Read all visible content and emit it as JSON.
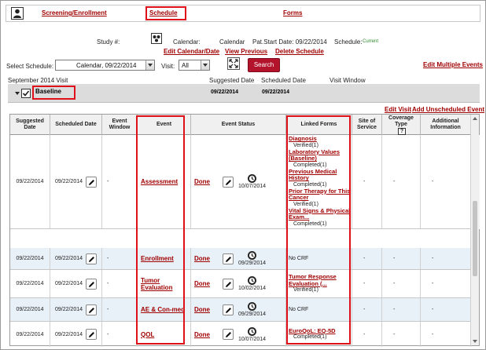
{
  "nav": {
    "tabs": [
      "Screening/Enrollment",
      "Schedule",
      "Forms"
    ]
  },
  "calendar_info": {
    "study_label": "Study #:",
    "calendar_label": "Calendar:",
    "calendar_value": "Calendar",
    "pat_start": "Pat.Start Date: 09/22/2014",
    "schedule_label": "Schedule:",
    "schedule_status": "Current",
    "links": {
      "edit_calendar": "Edit Calendar/Date",
      "view_previous": "View Previous",
      "delete_schedule": "Delete Schedule"
    }
  },
  "selection": {
    "select_schedule_label": "Select Schedule:",
    "schedule_value": "Calendar, 09/22/2014",
    "visit_label": "Visit:",
    "visit_value": "All",
    "search_button": "Search",
    "edit_multiple_events": "Edit Multiple Events"
  },
  "visit_header": {
    "month": "September 2014 Visit",
    "suggested_date": "Suggested Date",
    "scheduled_date": "Scheduled Date",
    "visit_window": "Visit Window"
  },
  "baseline": {
    "name": "Baseline",
    "suggested": "09/22/2014",
    "scheduled": "09/22/2014"
  },
  "visit_links": {
    "edit_visit": "Edit Visit",
    "add_unscheduled": "Add Unscheduled Event"
  },
  "table": {
    "headers": [
      "Suggested Date",
      "Scheduled Date",
      "Event Window",
      "Event",
      "Event Status",
      "Linked Forms",
      "Site of Service",
      "Coverage Type",
      "Additional Information"
    ],
    "coverage_help": "?",
    "rows": [
      {
        "suggested": "09/22/2014",
        "scheduled": "09/22/2014",
        "window": "-",
        "event": "Assessment",
        "status": "Done",
        "status_date": "10/07/2014",
        "forms": [
          {
            "name": "Diagnosis",
            "status": "Verified(1)"
          },
          {
            "name": "Laboratory Values (Baseline)",
            "status": "Completed(1)"
          },
          {
            "name": "Previous Medical History",
            "status": "Completed(1)"
          },
          {
            "name": "Prior Therapy for This Cancer",
            "status": "Verified(1)"
          },
          {
            "name": "Vital Signs & Physical Exam...",
            "status": "Completed(1)"
          }
        ],
        "site": "-",
        "coverage": "-",
        "info": "-"
      },
      {
        "suggested": "09/22/2014",
        "scheduled": "09/22/2014",
        "window": "-",
        "event": "Enrollment",
        "status": "Done",
        "status_date": "09/29/2014",
        "forms_text": "No CRF",
        "site": "-",
        "coverage": "-",
        "info": "-"
      },
      {
        "suggested": "09/22/2014",
        "scheduled": "09/22/2014",
        "window": "-",
        "event": "Tumor Evaluation",
        "status": "Done",
        "status_date": "10/02/2014",
        "forms": [
          {
            "name": "Tumor Response Evaluation (...",
            "status": "Verified(1)"
          }
        ],
        "site": "-",
        "coverage": "-",
        "info": "-"
      },
      {
        "suggested": "09/22/2014",
        "scheduled": "09/22/2014",
        "window": "-",
        "event": "AE & Con-med",
        "status": "Done",
        "status_date": "09/29/2014",
        "forms_text": "No CRF",
        "site": "-",
        "coverage": "-",
        "info": "-"
      },
      {
        "suggested": "09/22/2014",
        "scheduled": "09/22/2014",
        "window": "-",
        "event": "QOL",
        "status": "Done",
        "status_date": "10/07/2014",
        "forms": [
          {
            "name": "EuroQoL: EQ-5D",
            "status": "Completed(1)"
          }
        ],
        "site": "-",
        "coverage": "-",
        "info": "-"
      }
    ]
  },
  "colors": {
    "link": "#a00000",
    "highlight": "#e0101a",
    "button": "#b3132b",
    "current": "#2a8a2a"
  }
}
